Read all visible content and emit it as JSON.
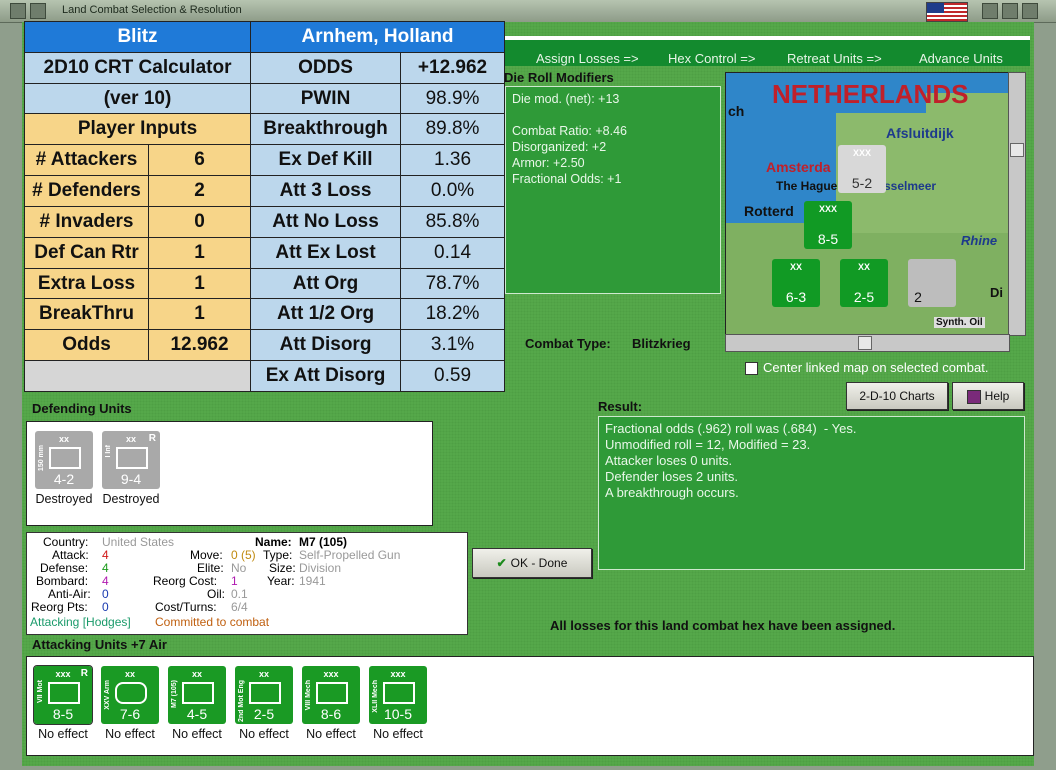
{
  "window": {
    "title": "Land Combat Selection & Resolution"
  },
  "calc": {
    "header_left": "Blitz",
    "header_right": "Arnhem, Holland",
    "title_line1": "2D10 CRT Calculator",
    "title_line2": "(ver 10)",
    "player_inputs": "Player Inputs",
    "inputs": [
      {
        "label": "# Attackers",
        "value": "6"
      },
      {
        "label": "# Defenders",
        "value": "2"
      },
      {
        "label": "# Invaders",
        "value": "0"
      },
      {
        "label": "Def Can Rtr",
        "value": "1"
      },
      {
        "label": "Extra Loss",
        "value": "1"
      },
      {
        "label": "BreakThru",
        "value": "1"
      },
      {
        "label": "Odds",
        "value": "12.962"
      }
    ],
    "results": [
      {
        "label": "ODDS",
        "value": "+12.962"
      },
      {
        "label": "PWIN",
        "value": "98.9%"
      },
      {
        "label": "Breakthrough",
        "value": "89.8%"
      },
      {
        "label": "Ex Def Kill",
        "value": "1.36"
      },
      {
        "label": "Att 3 Loss",
        "value": "0.0%"
      },
      {
        "label": "Att No Loss",
        "value": "85.8%"
      },
      {
        "label": "Att Ex Lost",
        "value": "0.14"
      },
      {
        "label": "Att Org",
        "value": "78.7%"
      },
      {
        "label": "Att 1/2 Org",
        "value": "18.2%"
      },
      {
        "label": "Att Disorg",
        "value": "3.1%"
      },
      {
        "label": "Ex Att Disorg",
        "value": "0.59"
      }
    ]
  },
  "phases": [
    "Assign Losses =>",
    "Hex Control =>",
    "Retreat Units =>",
    "Advance Units"
  ],
  "modifiers": {
    "title": "Die Roll Modifiers",
    "text": "Die mod. (net): +13\n\nCombat Ratio: +8.46\nDisorganized: +2\nArmor: +2.50\nFractional Odds: +1"
  },
  "map": {
    "title": "NETHERLANDS",
    "labels": [
      "Afsluitdijk",
      "Amsterda",
      "The Hague",
      "sselmeer",
      "Rotterd",
      "Rhine",
      "Di",
      "ch",
      "Synth. Oil"
    ],
    "units": [
      {
        "size": "XXX",
        "strength": "5-2"
      },
      {
        "size": "XXX",
        "strength": "8-5"
      },
      {
        "size": "XX",
        "strength": "6-3"
      },
      {
        "size": "XX",
        "strength": "2-5"
      },
      {
        "size": "",
        "strength": "2"
      }
    ]
  },
  "combat_type": {
    "label": "Combat Type:",
    "value": "Blitzkrieg"
  },
  "center_map": "Center linked map on selected combat.",
  "buttons": {
    "charts": "2-D-10 Charts",
    "help": "Help",
    "ok": "OK - Done"
  },
  "result": {
    "title": "Result:",
    "text": "Fractional odds (.962) roll was (.684)  - Yes.\nUnmodified roll = 12, Modified = 23.\nAttacker loses 0 units.\nDefender loses 2 units.\nA breakthrough occurs."
  },
  "defending": {
    "title": "Defending Units",
    "units": [
      {
        "size": "xx",
        "side": "150 mm",
        "strength": "4-2",
        "caption": "Destroyed",
        "r": ""
      },
      {
        "size": "xx",
        "side": "I Inf",
        "strength": "9-4",
        "caption": "Destroyed",
        "r": "R"
      }
    ]
  },
  "info": {
    "country_label": "Country:",
    "country": "United States",
    "attack_label": "Attack:",
    "attack": "4",
    "defense_label": "Defense:",
    "defense": "4",
    "bombard_label": "Bombard:",
    "bombard": "4",
    "antiair_label": "Anti-Air:",
    "antiair": "0",
    "reorg_label": "Reorg Pts:",
    "reorg": "0",
    "move_label": "Move:",
    "move": "0 (5)",
    "elite_label": "Elite:",
    "elite": "No",
    "reorgcost_label": "Reorg Cost:",
    "reorgcost": "1",
    "oil_label": "Oil:",
    "oil": "0.1",
    "cost_label": "Cost/Turns:",
    "cost": "6/4",
    "name_label": "Name:",
    "name": "M7 (105)",
    "type_label": "Type:",
    "type": "Self-Propelled Gun",
    "size_label": "Size:",
    "size": "Division",
    "year_label": "Year:",
    "year": "1941",
    "attacking": "Attacking [Hodges]",
    "committed": "Committed to combat"
  },
  "status": "All losses for this land combat hex have been assigned.",
  "attacking": {
    "title": "Attacking Units +7 Air",
    "units": [
      {
        "size": "xxx",
        "side": "VII Mot",
        "strength": "8-5",
        "caption": "No effect",
        "r": "R"
      },
      {
        "size": "xx",
        "side": "XXV Arm",
        "strength": "7-6",
        "caption": "No effect",
        "r": ""
      },
      {
        "size": "xx",
        "side": "M7 (105)",
        "strength": "4-5",
        "caption": "No effect",
        "r": ""
      },
      {
        "size": "xx",
        "side": "2nd Mot Eng",
        "strength": "2-5",
        "caption": "No effect",
        "r": ""
      },
      {
        "size": "xxx",
        "side": "VIII Mech",
        "strength": "8-6",
        "caption": "No effect",
        "r": ""
      },
      {
        "size": "xxx",
        "side": "XLII Mech",
        "strength": "10-5",
        "caption": "No effect",
        "r": ""
      }
    ]
  },
  "colors": {
    "panel_green": "#2f9a38",
    "calc_blue": "#1f7ad8",
    "calc_orange": "#f7d589",
    "calc_light": "#bcd7ec"
  }
}
